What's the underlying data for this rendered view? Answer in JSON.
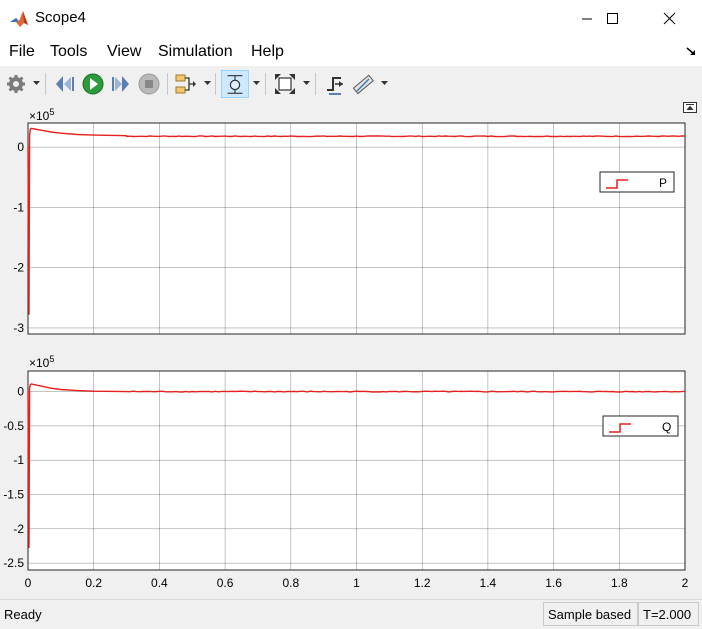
{
  "window": {
    "title": "Scope4"
  },
  "menu": [
    "File",
    "Tools",
    "View",
    "Simulation",
    "Help"
  ],
  "toolbar": {
    "icons": [
      "gear-icon",
      "step-back-icon",
      "run-icon",
      "step-forward-icon",
      "stop-icon",
      "signal-select-icon",
      "zoom-icon",
      "fit-to-view-icon",
      "triggers-icon",
      "measurements-icon"
    ],
    "pressed": "zoom-icon"
  },
  "colors": {
    "signal": "#e5211d",
    "grid": "#262626"
  },
  "plots": [
    {
      "exponent": "5",
      "y_ticks": [
        {
          "value": 0,
          "label": "0"
        },
        {
          "value": -1,
          "label": "-1"
        },
        {
          "value": -2,
          "label": "-2"
        },
        {
          "value": -3,
          "label": "-3"
        }
      ],
      "legend": "P"
    },
    {
      "exponent": "5",
      "y_ticks": [
        {
          "value": 0,
          "label": "0"
        },
        {
          "value": -0.5,
          "label": "-0.5"
        },
        {
          "value": -1,
          "label": "-1"
        },
        {
          "value": -1.5,
          "label": "-1.5"
        },
        {
          "value": -2,
          "label": "-2"
        },
        {
          "value": -2.5,
          "label": "-2.5"
        }
      ],
      "legend": "Q"
    }
  ],
  "x_ticks": [
    "0",
    "0.2",
    "0.4",
    "0.6",
    "0.8",
    "1",
    "1.2",
    "1.4",
    "1.6",
    "1.8",
    "2"
  ],
  "chart_data": [
    {
      "type": "line",
      "xlim": [
        0,
        2
      ],
      "ylim": [
        -3.1,
        0.4
      ],
      "y_multiplier": "×10^5",
      "grid": true,
      "legend_position": "right",
      "series": [
        {
          "name": "P",
          "x": [
            0,
            0.003,
            0.005,
            0.007,
            0.01,
            0.02,
            0.04,
            0.07,
            0.1,
            0.15,
            0.2,
            0.3,
            0.5,
            1,
            1.5,
            2
          ],
          "y": [
            0,
            -2.78,
            0.2,
            0.3,
            0.31,
            0.3,
            0.28,
            0.25,
            0.23,
            0.21,
            0.2,
            0.19,
            0.18,
            0.18,
            0.18,
            0.18
          ]
        }
      ]
    },
    {
      "type": "line",
      "xlim": [
        0,
        2
      ],
      "ylim": [
        -2.6,
        0.3
      ],
      "y_multiplier": "×10^5",
      "grid": true,
      "legend_position": "right",
      "series": [
        {
          "name": "Q",
          "x": [
            0,
            0.003,
            0.005,
            0.007,
            0.01,
            0.02,
            0.04,
            0.07,
            0.1,
            0.15,
            0.2,
            0.3,
            0.5,
            1,
            1.5,
            2
          ],
          "y": [
            0,
            -2.28,
            0.05,
            0.1,
            0.11,
            0.1,
            0.08,
            0.05,
            0.03,
            0.015,
            0.005,
            0,
            0,
            0,
            0,
            0
          ]
        }
      ]
    }
  ],
  "status": {
    "ready": "Ready",
    "mode": "Sample based",
    "time": "T=2.000"
  }
}
